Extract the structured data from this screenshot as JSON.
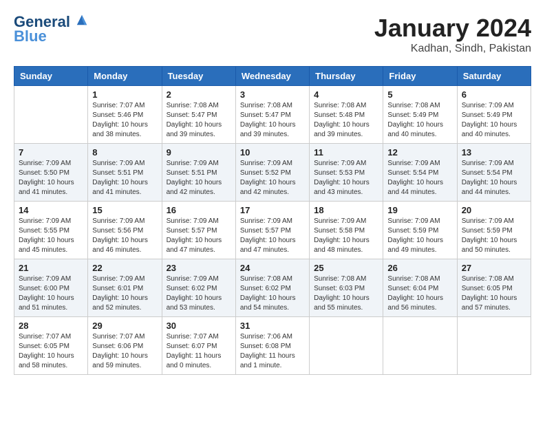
{
  "header": {
    "logo_line1": "General",
    "logo_line2": "Blue",
    "month_year": "January 2024",
    "location": "Kadhan, Sindh, Pakistan"
  },
  "columns": [
    "Sunday",
    "Monday",
    "Tuesday",
    "Wednesday",
    "Thursday",
    "Friday",
    "Saturday"
  ],
  "weeks": [
    [
      {
        "day": "",
        "sunrise": "",
        "sunset": "",
        "daylight": ""
      },
      {
        "day": "1",
        "sunrise": "Sunrise: 7:07 AM",
        "sunset": "Sunset: 5:46 PM",
        "daylight": "Daylight: 10 hours and 38 minutes."
      },
      {
        "day": "2",
        "sunrise": "Sunrise: 7:08 AM",
        "sunset": "Sunset: 5:47 PM",
        "daylight": "Daylight: 10 hours and 39 minutes."
      },
      {
        "day": "3",
        "sunrise": "Sunrise: 7:08 AM",
        "sunset": "Sunset: 5:47 PM",
        "daylight": "Daylight: 10 hours and 39 minutes."
      },
      {
        "day": "4",
        "sunrise": "Sunrise: 7:08 AM",
        "sunset": "Sunset: 5:48 PM",
        "daylight": "Daylight: 10 hours and 39 minutes."
      },
      {
        "day": "5",
        "sunrise": "Sunrise: 7:08 AM",
        "sunset": "Sunset: 5:49 PM",
        "daylight": "Daylight: 10 hours and 40 minutes."
      },
      {
        "day": "6",
        "sunrise": "Sunrise: 7:09 AM",
        "sunset": "Sunset: 5:49 PM",
        "daylight": "Daylight: 10 hours and 40 minutes."
      }
    ],
    [
      {
        "day": "7",
        "sunrise": "Sunrise: 7:09 AM",
        "sunset": "Sunset: 5:50 PM",
        "daylight": "Daylight: 10 hours and 41 minutes."
      },
      {
        "day": "8",
        "sunrise": "Sunrise: 7:09 AM",
        "sunset": "Sunset: 5:51 PM",
        "daylight": "Daylight: 10 hours and 41 minutes."
      },
      {
        "day": "9",
        "sunrise": "Sunrise: 7:09 AM",
        "sunset": "Sunset: 5:51 PM",
        "daylight": "Daylight: 10 hours and 42 minutes."
      },
      {
        "day": "10",
        "sunrise": "Sunrise: 7:09 AM",
        "sunset": "Sunset: 5:52 PM",
        "daylight": "Daylight: 10 hours and 42 minutes."
      },
      {
        "day": "11",
        "sunrise": "Sunrise: 7:09 AM",
        "sunset": "Sunset: 5:53 PM",
        "daylight": "Daylight: 10 hours and 43 minutes."
      },
      {
        "day": "12",
        "sunrise": "Sunrise: 7:09 AM",
        "sunset": "Sunset: 5:54 PM",
        "daylight": "Daylight: 10 hours and 44 minutes."
      },
      {
        "day": "13",
        "sunrise": "Sunrise: 7:09 AM",
        "sunset": "Sunset: 5:54 PM",
        "daylight": "Daylight: 10 hours and 44 minutes."
      }
    ],
    [
      {
        "day": "14",
        "sunrise": "Sunrise: 7:09 AM",
        "sunset": "Sunset: 5:55 PM",
        "daylight": "Daylight: 10 hours and 45 minutes."
      },
      {
        "day": "15",
        "sunrise": "Sunrise: 7:09 AM",
        "sunset": "Sunset: 5:56 PM",
        "daylight": "Daylight: 10 hours and 46 minutes."
      },
      {
        "day": "16",
        "sunrise": "Sunrise: 7:09 AM",
        "sunset": "Sunset: 5:57 PM",
        "daylight": "Daylight: 10 hours and 47 minutes."
      },
      {
        "day": "17",
        "sunrise": "Sunrise: 7:09 AM",
        "sunset": "Sunset: 5:57 PM",
        "daylight": "Daylight: 10 hours and 47 minutes."
      },
      {
        "day": "18",
        "sunrise": "Sunrise: 7:09 AM",
        "sunset": "Sunset: 5:58 PM",
        "daylight": "Daylight: 10 hours and 48 minutes."
      },
      {
        "day": "19",
        "sunrise": "Sunrise: 7:09 AM",
        "sunset": "Sunset: 5:59 PM",
        "daylight": "Daylight: 10 hours and 49 minutes."
      },
      {
        "day": "20",
        "sunrise": "Sunrise: 7:09 AM",
        "sunset": "Sunset: 5:59 PM",
        "daylight": "Daylight: 10 hours and 50 minutes."
      }
    ],
    [
      {
        "day": "21",
        "sunrise": "Sunrise: 7:09 AM",
        "sunset": "Sunset: 6:00 PM",
        "daylight": "Daylight: 10 hours and 51 minutes."
      },
      {
        "day": "22",
        "sunrise": "Sunrise: 7:09 AM",
        "sunset": "Sunset: 6:01 PM",
        "daylight": "Daylight: 10 hours and 52 minutes."
      },
      {
        "day": "23",
        "sunrise": "Sunrise: 7:09 AM",
        "sunset": "Sunset: 6:02 PM",
        "daylight": "Daylight: 10 hours and 53 minutes."
      },
      {
        "day": "24",
        "sunrise": "Sunrise: 7:08 AM",
        "sunset": "Sunset: 6:02 PM",
        "daylight": "Daylight: 10 hours and 54 minutes."
      },
      {
        "day": "25",
        "sunrise": "Sunrise: 7:08 AM",
        "sunset": "Sunset: 6:03 PM",
        "daylight": "Daylight: 10 hours and 55 minutes."
      },
      {
        "day": "26",
        "sunrise": "Sunrise: 7:08 AM",
        "sunset": "Sunset: 6:04 PM",
        "daylight": "Daylight: 10 hours and 56 minutes."
      },
      {
        "day": "27",
        "sunrise": "Sunrise: 7:08 AM",
        "sunset": "Sunset: 6:05 PM",
        "daylight": "Daylight: 10 hours and 57 minutes."
      }
    ],
    [
      {
        "day": "28",
        "sunrise": "Sunrise: 7:07 AM",
        "sunset": "Sunset: 6:05 PM",
        "daylight": "Daylight: 10 hours and 58 minutes."
      },
      {
        "day": "29",
        "sunrise": "Sunrise: 7:07 AM",
        "sunset": "Sunset: 6:06 PM",
        "daylight": "Daylight: 10 hours and 59 minutes."
      },
      {
        "day": "30",
        "sunrise": "Sunrise: 7:07 AM",
        "sunset": "Sunset: 6:07 PM",
        "daylight": "Daylight: 11 hours and 0 minutes."
      },
      {
        "day": "31",
        "sunrise": "Sunrise: 7:06 AM",
        "sunset": "Sunset: 6:08 PM",
        "daylight": "Daylight: 11 hours and 1 minute."
      },
      {
        "day": "",
        "sunrise": "",
        "sunset": "",
        "daylight": ""
      },
      {
        "day": "",
        "sunrise": "",
        "sunset": "",
        "daylight": ""
      },
      {
        "day": "",
        "sunrise": "",
        "sunset": "",
        "daylight": ""
      }
    ]
  ]
}
